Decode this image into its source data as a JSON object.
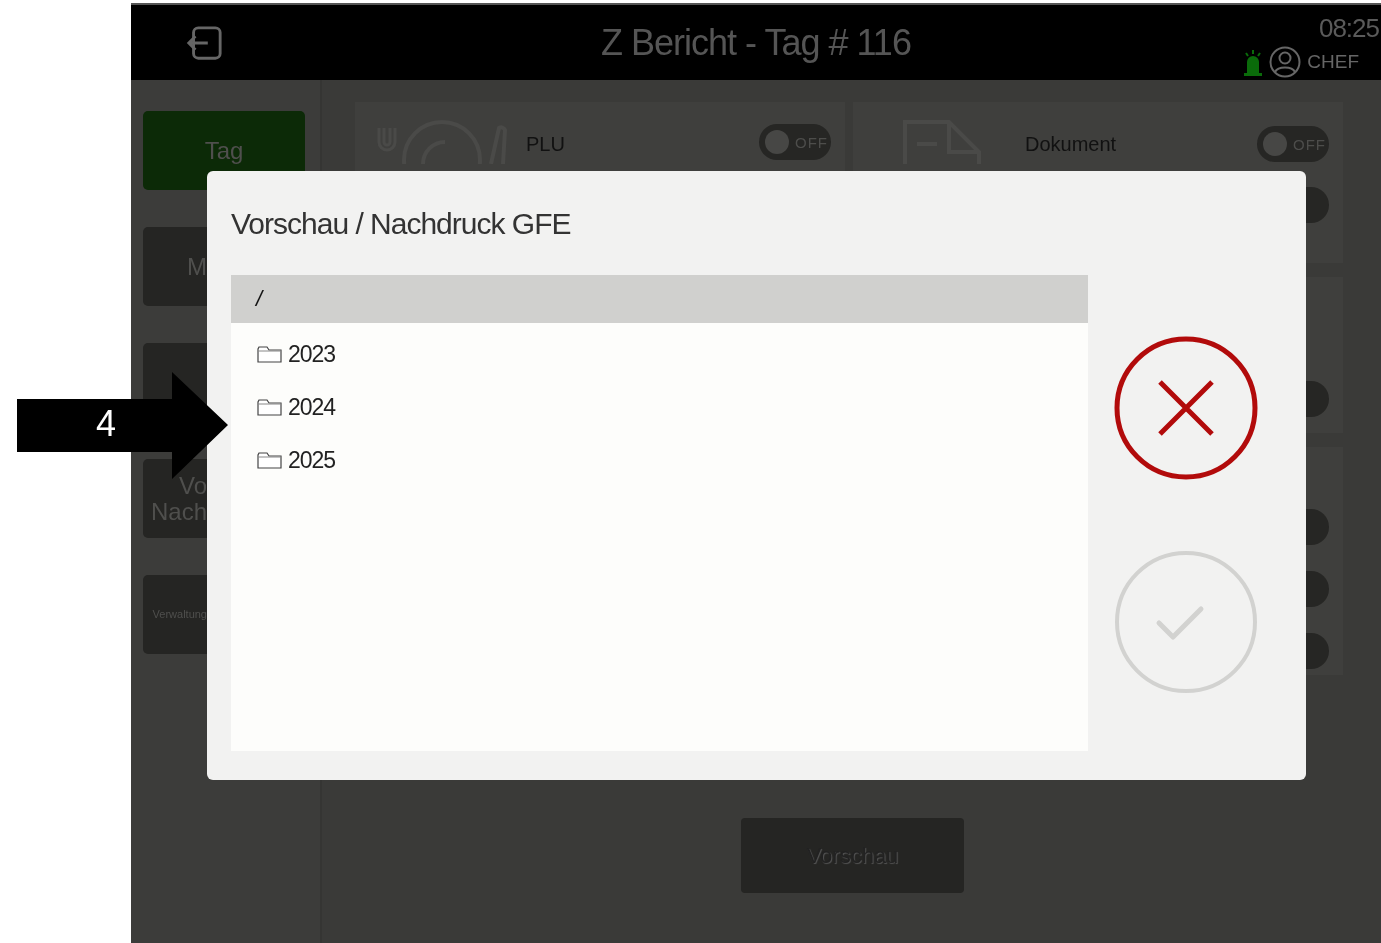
{
  "header": {
    "title": "Z Bericht - Tag # 116",
    "time": "08:25",
    "user": "CHEF"
  },
  "sidebar": {
    "items": [
      {
        "label": [
          "Tag"
        ],
        "selected": true
      },
      {
        "label": [
          "M"
        ],
        "selected": false
      },
      {
        "selected": false
      },
      {
        "label": [
          "Vo",
          "Nach"
        ],
        "selected": false
      },
      {
        "label": [
          "Verwaltung"
        ],
        "selected": false,
        "kind": "small"
      }
    ]
  },
  "options": [
    {
      "label": "PLU",
      "toggles": [
        {
          "text": "OFF",
          "on": false
        }
      ]
    },
    {
      "label": "Dokument",
      "toggles": [
        {
          "text": "OFF",
          "on": false
        },
        {
          "on": false
        }
      ]
    },
    {
      "toggles": [
        {
          "on": false
        }
      ]
    },
    {
      "toggles": [
        {
          "on": false
        },
        {
          "on": false
        },
        {
          "on": false
        }
      ]
    }
  ],
  "preview_button": "Vorschau",
  "dialog": {
    "title": "Vorschau / Nachdruck GFE",
    "path": "/",
    "folders": [
      {
        "name": "2023",
        "selected": false
      },
      {
        "name": "2024",
        "selected": false
      },
      {
        "name": "2025",
        "selected": false
      }
    ],
    "ok_enabled": false
  },
  "annotation": {
    "number": "4"
  }
}
